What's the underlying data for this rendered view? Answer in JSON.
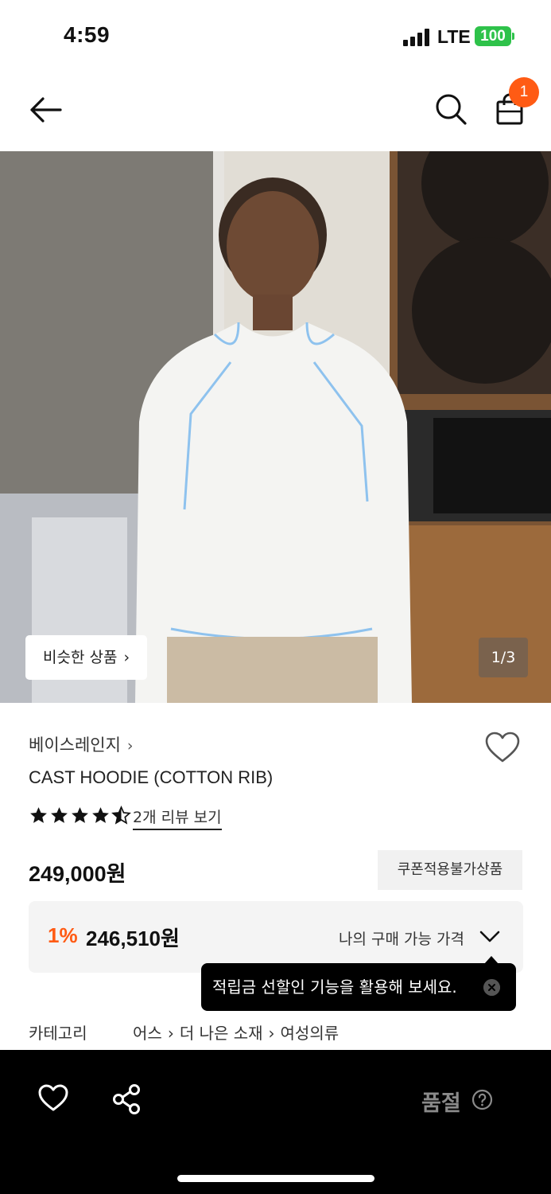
{
  "status_bar": {
    "time": "4:59",
    "network": "LTE",
    "battery": "100"
  },
  "nav": {
    "cart_count": "1"
  },
  "hero": {
    "similar_label": "비슷한 상품",
    "counter": "1/3"
  },
  "product": {
    "brand": "베이스레인지",
    "name": "CAST HOODIE (COTTON RIB)",
    "rating": 4.5,
    "review_link": "2개 리뷰 보기",
    "price": "249,000원",
    "coupon_tag": "쿠폰적용불가상품",
    "discount": "1%",
    "my_price": "246,510원",
    "my_price_label": "나의 구매 가능 가격"
  },
  "tooltip": {
    "text": "적립금 선할인 기능을 활용해 보세요."
  },
  "category": {
    "label": "카테고리",
    "path": [
      "어스",
      "더 나은 소재",
      "여성의류"
    ]
  },
  "bottom_bar": {
    "status": "품절"
  },
  "colors": {
    "accent": "#ff5b14",
    "battery": "#2ec24a",
    "bar": "#000000"
  }
}
